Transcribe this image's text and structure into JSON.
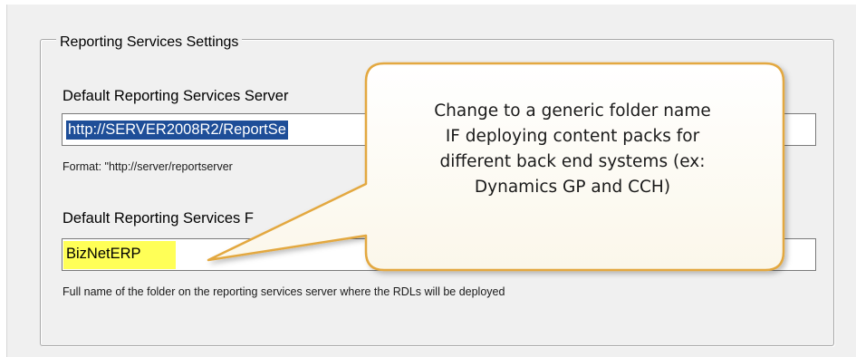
{
  "group": {
    "title": "Reporting Services Settings"
  },
  "server": {
    "label": "Default Reporting Services Server",
    "value": "http://SERVER2008R2/ReportSe",
    "format_hint": "Format: \"http://server/reportserver"
  },
  "folder": {
    "label": "Default Reporting Services F",
    "value": "BizNetERP",
    "hint": "Full name of the folder on the reporting services server where the RDLs will be deployed"
  },
  "callout": {
    "text": "Change to a generic folder name\nIF deploying content packs for\ndifferent back end systems (ex:\nDynamics GP and CCH)",
    "fill_color": "#fffdf2",
    "stroke_color": "#e3a83f"
  },
  "colors": {
    "selection": "#1e4e98",
    "highlight": "#ffff57"
  }
}
